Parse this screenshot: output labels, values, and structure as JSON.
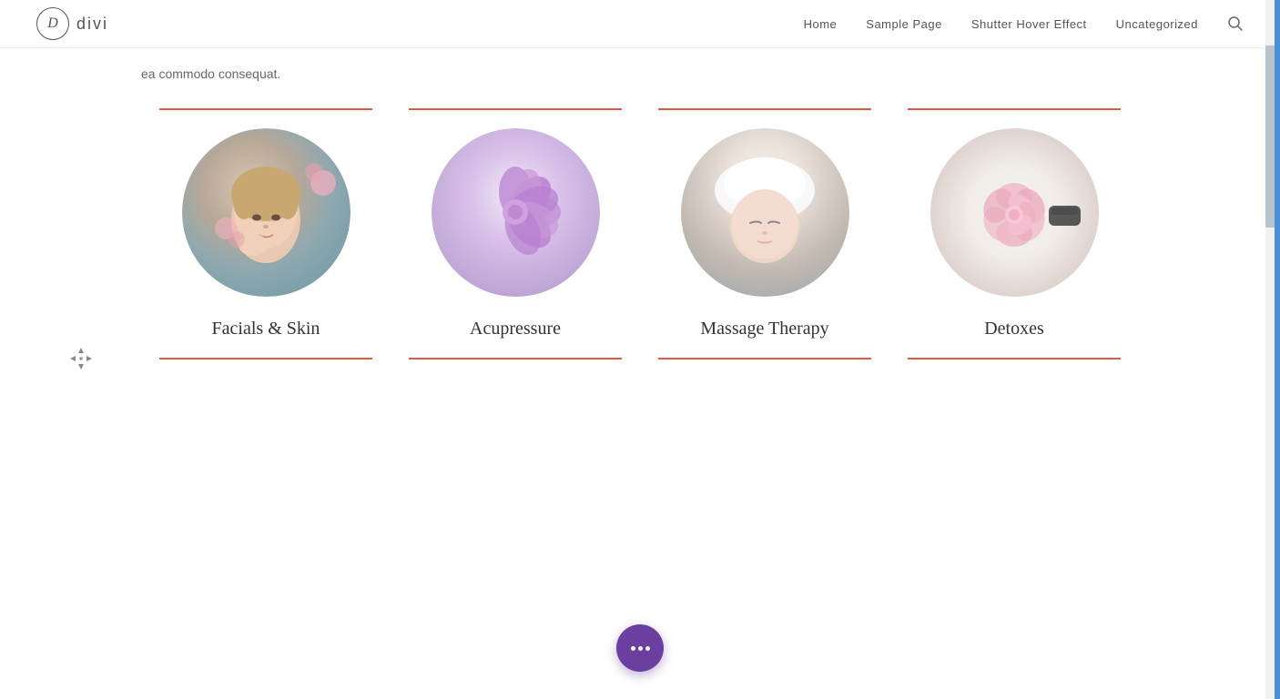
{
  "header": {
    "logo_letter": "D",
    "logo_name": "divi",
    "nav_items": [
      {
        "label": "Home",
        "id": "home"
      },
      {
        "label": "Sample Page",
        "id": "sample-page"
      },
      {
        "label": "Shutter Hover Effect",
        "id": "shutter-hover"
      },
      {
        "label": "Uncategorized",
        "id": "uncategorized"
      }
    ],
    "search_icon": "🔍"
  },
  "intro": {
    "text": "ea commodo consequat."
  },
  "cards": [
    {
      "id": "facials",
      "title": "Facials & Skin",
      "img_type": "facials"
    },
    {
      "id": "acupressure",
      "title": "Acupressure",
      "img_type": "acupressure"
    },
    {
      "id": "massage",
      "title": "Massage Therapy",
      "img_type": "massage"
    },
    {
      "id": "detoxes",
      "title": "Detoxes",
      "img_type": "detoxes"
    }
  ],
  "colors": {
    "accent_line": "#e05a40",
    "chat_bubble": "#6b3fa0"
  },
  "chat": {
    "label": "···"
  }
}
